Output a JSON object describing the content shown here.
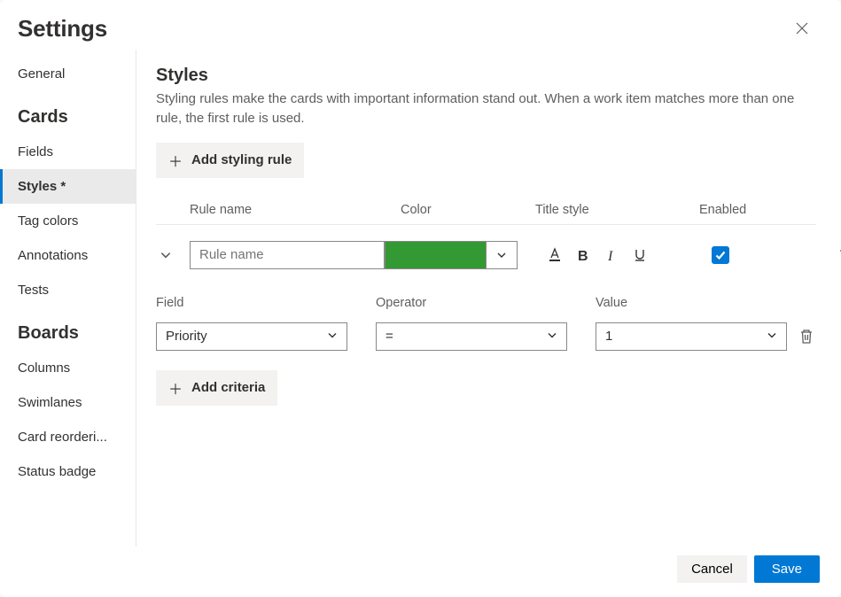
{
  "header": {
    "title": "Settings"
  },
  "sidebar": {
    "general": "General",
    "section_cards": "Cards",
    "fields": "Fields",
    "styles": "Styles *",
    "tag_colors": "Tag colors",
    "annotations": "Annotations",
    "tests": "Tests",
    "section_boards": "Boards",
    "columns": "Columns",
    "swimlanes": "Swimlanes",
    "card_reorder": "Card reorderi...",
    "status_badge": "Status badge"
  },
  "main": {
    "title": "Styles",
    "description": "Styling rules make the cards with important information stand out. When a work item matches more than one rule, the first rule is used.",
    "add_rule_label": "Add styling rule",
    "add_criteria_label": "Add criteria",
    "cols": {
      "rule_name": "Rule name",
      "color": "Color",
      "title_style": "Title style",
      "enabled": "Enabled"
    },
    "rule": {
      "name_placeholder": "Rule name",
      "color": "#339933",
      "enabled": true
    },
    "criteria_cols": {
      "field": "Field",
      "operator": "Operator",
      "value": "Value"
    },
    "criteria": {
      "field": "Priority",
      "operator": "=",
      "value": "1"
    }
  },
  "footer": {
    "cancel": "Cancel",
    "save": "Save"
  }
}
